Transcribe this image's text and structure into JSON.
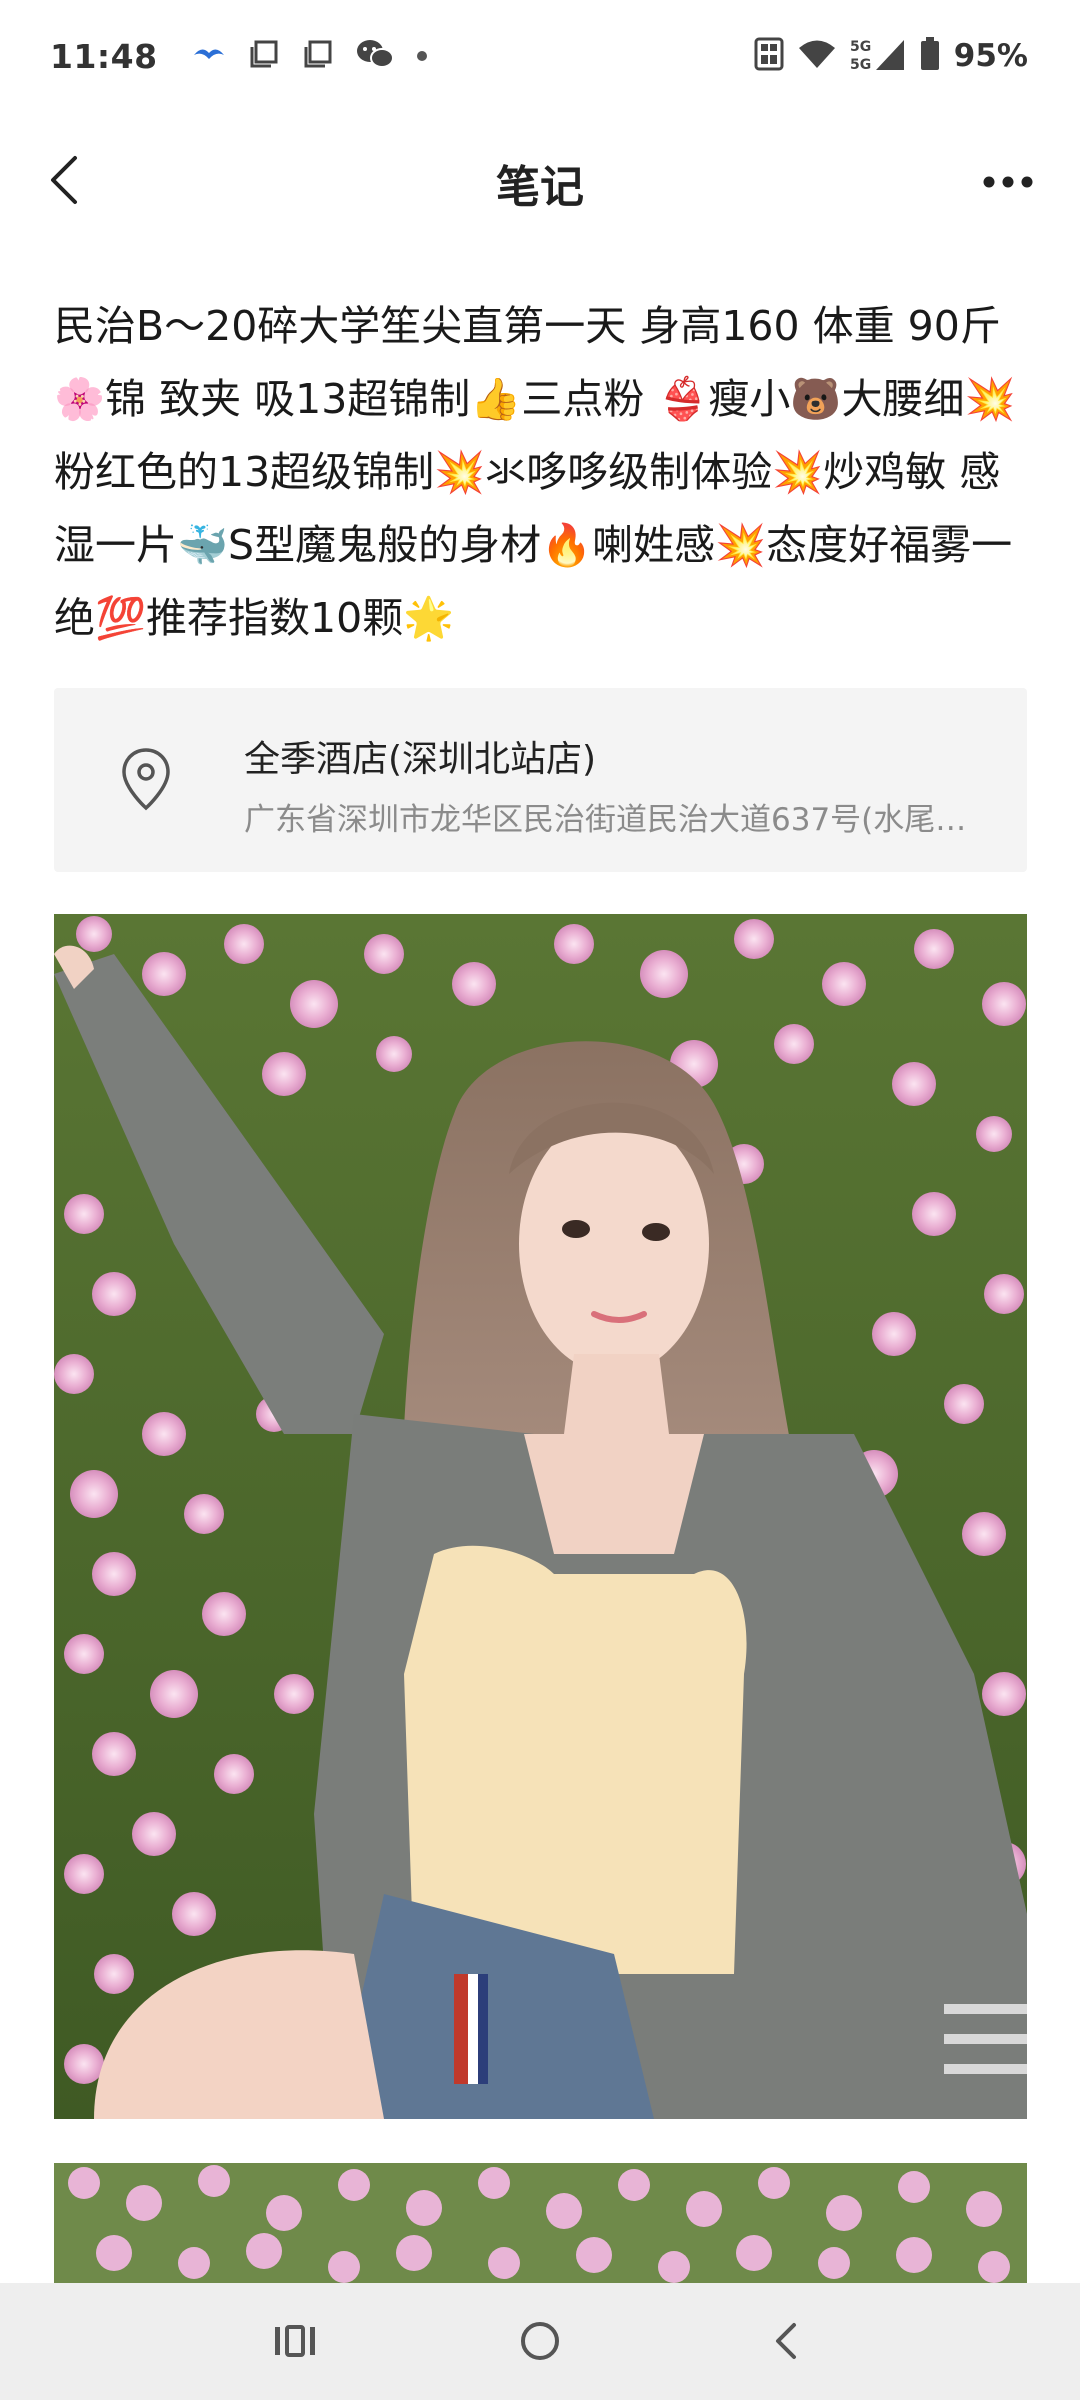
{
  "status_bar": {
    "time": "11:48",
    "battery": "95%",
    "network_label": "5G 5G",
    "icons": [
      "bird-app-icon",
      "copy-icon",
      "copy-icon",
      "wechat-icon",
      "dot-icon",
      "nfc-icon",
      "wifi-icon",
      "signal-icon",
      "battery-icon"
    ]
  },
  "header": {
    "title": "笔记",
    "back_icon": "chevron-left-icon",
    "more_icon": "more-dots-icon"
  },
  "post": {
    "text": "民治B～20碎大学笙尖直第一天 身高160 体重 90斤🌸锦 致夹 吸13超锦制👍三点粉 👙瘦小🐻大腰细💥粉红色的13超级锦制💥氺哆哆级制体验💥炒鸡敏 感湿一片🐳S型魔鬼般的身材🔥喇姓感💥态度好福雾一绝💯推荐指数10颗🌟"
  },
  "location": {
    "icon": "location-pin-icon",
    "name": "全季酒店(深圳北站店)",
    "address": "广东省深圳市龙华区民治街道民治大道637号(水尾…"
  },
  "photos": {
    "count": 2,
    "colors": {
      "grass": "#4f6a2e",
      "flower": "#e6a9cf",
      "cardigan": "#7a7d7a",
      "top": "#f6e2b8",
      "hair": "#9a8070",
      "skin": "#f3d6c8"
    }
  },
  "nav_bar": {
    "recent_icon": "recent-apps-icon",
    "home_icon": "home-circle-icon",
    "back_icon": "back-chevron-icon"
  }
}
